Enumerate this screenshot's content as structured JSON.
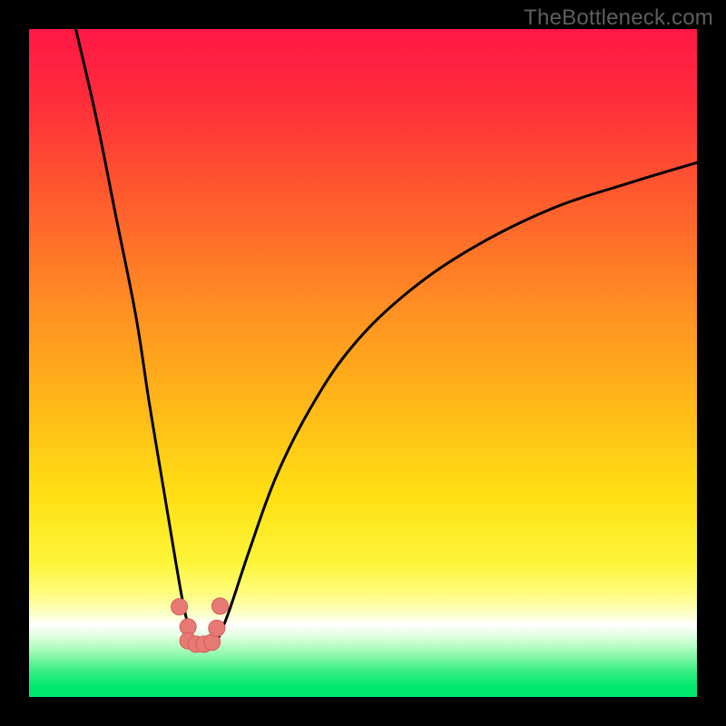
{
  "watermark": "TheBottleneck.com",
  "colors": {
    "frame_bg": "#000000",
    "watermark": "#5e5e5e",
    "curve_stroke": "#000000",
    "marker_fill": "#e77a74",
    "marker_stroke": "#d55c55"
  },
  "gradient_stops": [
    {
      "offset": 0.0,
      "color": "#ff1846"
    },
    {
      "offset": 0.1,
      "color": "#ff2b3b"
    },
    {
      "offset": 0.25,
      "color": "#ff5a2e"
    },
    {
      "offset": 0.4,
      "color": "#ff8a24"
    },
    {
      "offset": 0.55,
      "color": "#ffb419"
    },
    {
      "offset": 0.7,
      "color": "#ffe013"
    },
    {
      "offset": 0.8,
      "color": "#fdf53a"
    },
    {
      "offset": 0.845,
      "color": "#fffb7e"
    },
    {
      "offset": 0.878,
      "color": "#fbffcf"
    },
    {
      "offset": 0.892,
      "color": "#ffffff"
    },
    {
      "offset": 0.91,
      "color": "#dcffdd"
    },
    {
      "offset": 0.93,
      "color": "#a6fbbb"
    },
    {
      "offset": 0.96,
      "color": "#3cef86"
    },
    {
      "offset": 0.985,
      "color": "#00e86e"
    },
    {
      "offset": 1.0,
      "color": "#00e86e"
    }
  ],
  "chart_data": {
    "type": "line",
    "title": "",
    "xlabel": "",
    "ylabel": "",
    "x_range": [
      0,
      100
    ],
    "y_range": [
      0,
      100
    ],
    "note": "Bottleneck-style curve. x is normalized component ratio (0–100), y is bottleneck magnitude in percent (0 = balanced/green, 100 = severe/red). Minimum around x≈26. Values estimated from gradient position.",
    "series": [
      {
        "name": "curve-left",
        "x": [
          7,
          10,
          13,
          16,
          18,
          20,
          22,
          23.5,
          25
        ],
        "y": [
          100,
          87,
          72,
          57,
          44,
          32,
          20,
          12,
          8
        ]
      },
      {
        "name": "curve-right",
        "x": [
          28,
          30,
          33,
          37,
          42,
          48,
          56,
          66,
          78,
          90,
          100
        ],
        "y": [
          8,
          13,
          22,
          33,
          43,
          52,
          60,
          67,
          73,
          77,
          80
        ]
      },
      {
        "name": "valley-floor",
        "x": [
          25,
          28
        ],
        "y": [
          8,
          8
        ]
      }
    ],
    "markers": {
      "name": "highlighted-points",
      "note": "Cluster of salmon dots near the valley (optimal zone).",
      "points": [
        {
          "x": 22.5,
          "y": 13.5
        },
        {
          "x": 23.8,
          "y": 10.5
        },
        {
          "x": 23.8,
          "y": 8.4
        },
        {
          "x": 25.0,
          "y": 7.9
        },
        {
          "x": 26.2,
          "y": 7.9
        },
        {
          "x": 27.4,
          "y": 8.2
        },
        {
          "x": 28.1,
          "y": 10.3
        },
        {
          "x": 28.6,
          "y": 13.6
        }
      ]
    }
  }
}
